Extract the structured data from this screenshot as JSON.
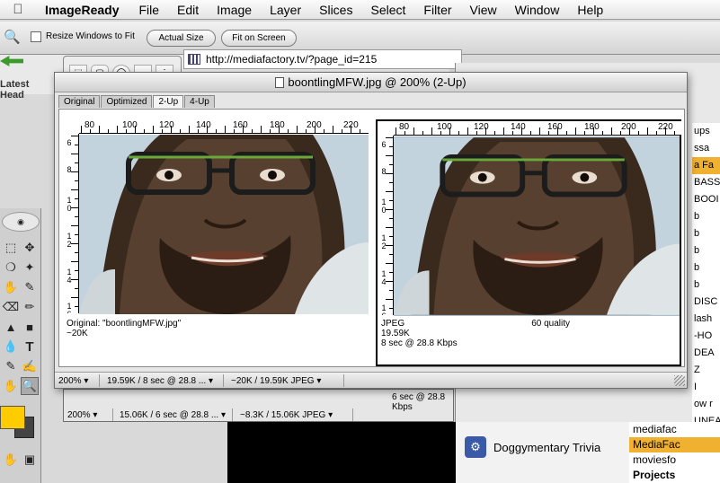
{
  "menubar": {
    "app_name": "ImageReady",
    "items": [
      "File",
      "Edit",
      "Image",
      "Layer",
      "Slices",
      "Select",
      "Filter",
      "View",
      "Window",
      "Help"
    ]
  },
  "options": {
    "resize_label": "Resize Windows to Fit",
    "actual_size_label": "Actual Size",
    "fit_screen_label": "Fit on Screen"
  },
  "browser": {
    "url": "http://mediafactory.tv/?page_id=215",
    "latest_label": "Latest Head"
  },
  "document": {
    "title": "boontlingMFW.jpg @ 200% (2-Up)",
    "tabs": [
      "Original",
      "Optimized",
      "2-Up",
      "4-Up"
    ],
    "active_tab": "2-Up",
    "ruler_ticks": [
      "80",
      "100",
      "120",
      "140",
      "160",
      "180",
      "200",
      "220"
    ],
    "vruler_labels": [
      "6",
      "8",
      "1\n0",
      "1\n2",
      "1\n4",
      "1\n6"
    ],
    "left_pane": {
      "line1": "Original: \"boontlingMFW.jpg\"",
      "line2": "~20K"
    },
    "right_pane": {
      "format": "JPEG",
      "quality": "60 quality",
      "size": "19.59K",
      "time": "8 sec @ 28.8 Kbps"
    },
    "status": {
      "zoom": "200%",
      "info1": "19.59K / 8 sec @ 28.8 ...",
      "info2": "~20K / 19.59K JPEG"
    }
  },
  "window2": {
    "hint": "6 sec @ 28.8 Kbps",
    "status": {
      "zoom": "200%",
      "info1": "15.06K / 6 sec @ 28.8 ...",
      "info2": "~8.3K / 15.06K JPEG"
    }
  },
  "right_list": [
    "ups",
    "ssa",
    "a Fa",
    "BASS",
    "BOOI",
    "b",
    "b",
    "b",
    "b",
    "b",
    "DISC",
    "lash",
    "-HO",
    "DEA",
    "Z",
    "I",
    "ow r",
    "UNEA"
  ],
  "bottom_right": [
    "mediafac",
    "MediaFac",
    "moviesfo",
    "Projects"
  ],
  "bottom_item": "Doggymentary Trivia",
  "colors": {
    "foreground": "#ffcc00",
    "background": "#444444",
    "highlight": "#f0b030"
  }
}
